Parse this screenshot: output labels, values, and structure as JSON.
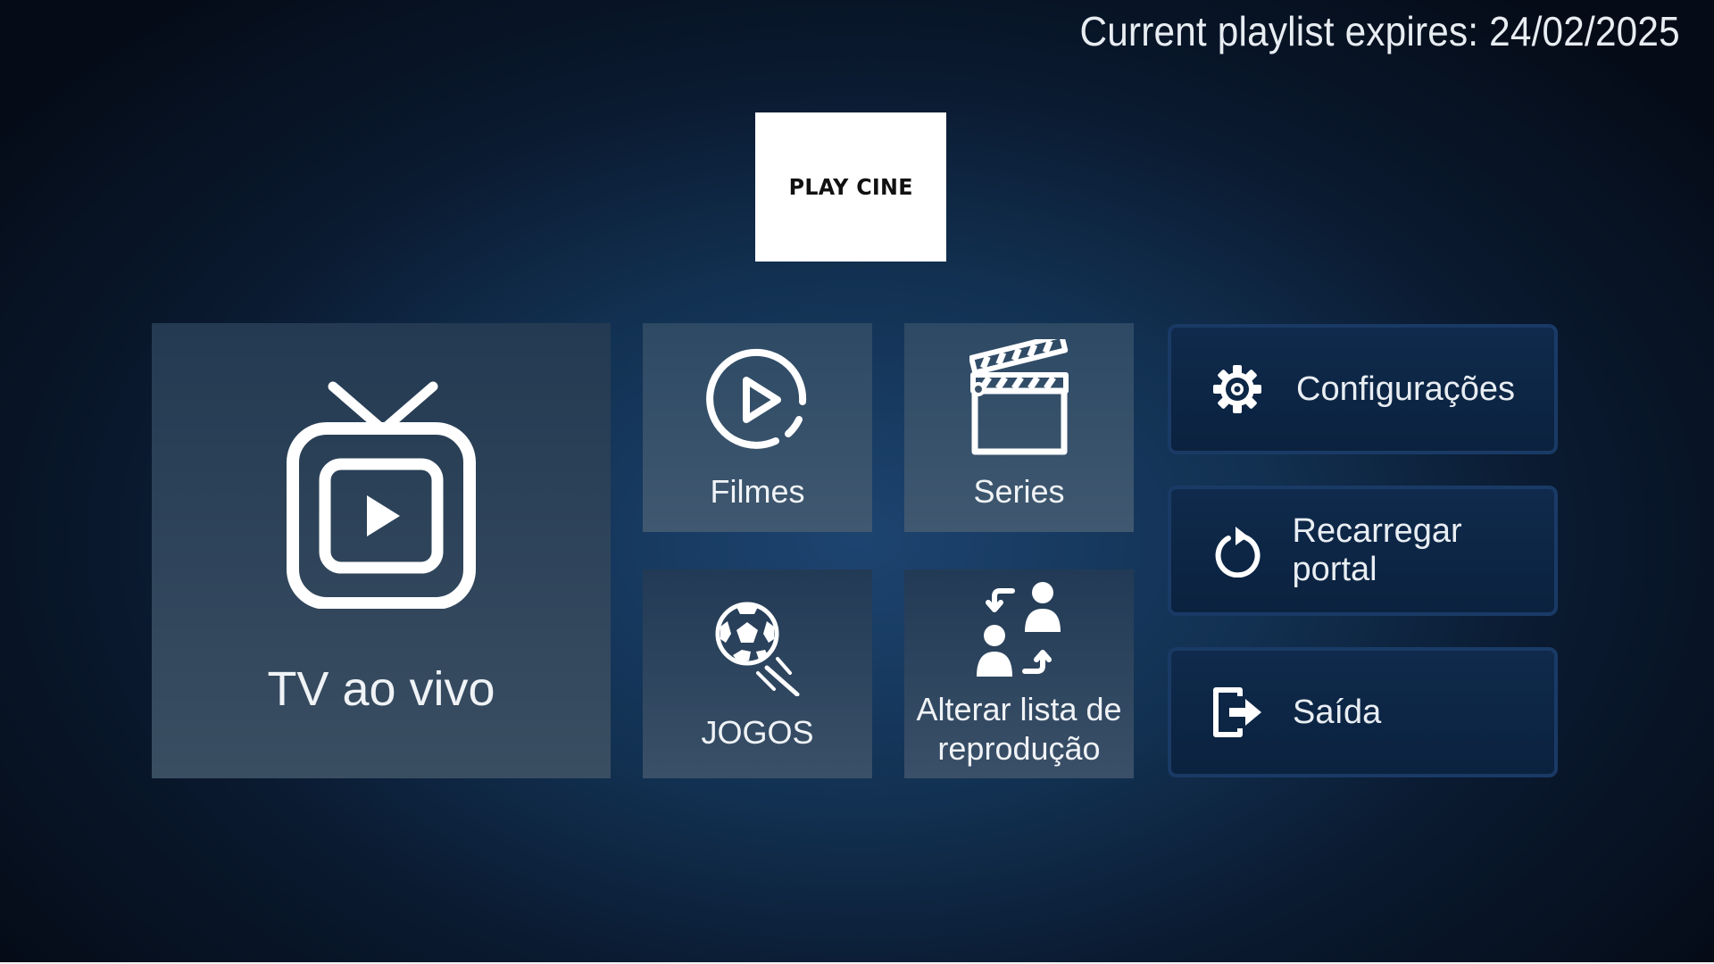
{
  "header": {
    "expiry_text": "Current playlist expires: 24/02/2025"
  },
  "logo": {
    "text": "PLAY CINE"
  },
  "tiles": {
    "tv": {
      "label": "TV ao vivo",
      "icon": "tv-play-icon"
    },
    "filmes": {
      "label": "Filmes",
      "icon": "play-circle-icon"
    },
    "series": {
      "label": "Series",
      "icon": "clapperboard-icon"
    },
    "jogos": {
      "label": "JOGOS",
      "icon": "soccer-ball-icon"
    },
    "lista": {
      "label_line1": "Alterar lista de",
      "label_line2": "reprodução",
      "icon": "switch-users-icon"
    }
  },
  "side_buttons": {
    "config": {
      "label": "Configurações",
      "icon": "gear-icon"
    },
    "reload": {
      "label": "Recarregar portal",
      "icon": "reload-icon"
    },
    "exit": {
      "label": "Saída",
      "icon": "exit-icon"
    }
  },
  "colors": {
    "background_center": "#1d4470",
    "background_edge": "#050c18",
    "button_border": "#1a3a66",
    "tile_fill": "#3a4e62",
    "text": "#f0f3f6"
  }
}
